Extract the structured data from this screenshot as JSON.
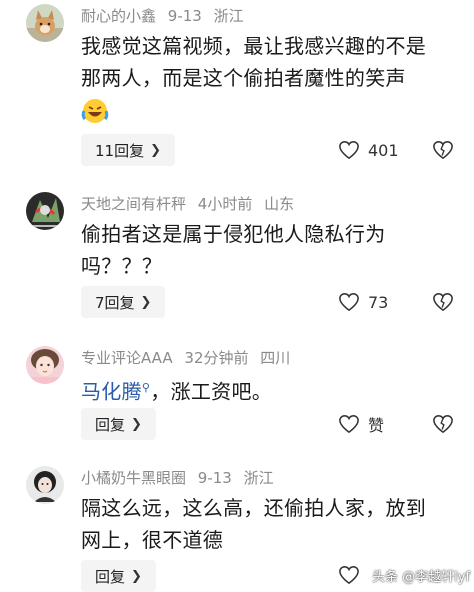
{
  "comments": [
    {
      "username": "耐心的小鑫",
      "date": "9-13",
      "location": "浙江",
      "line1": "我感觉这篇视频，最让我感兴趣的不是",
      "line2": "那两人，而是这个偷拍者魔性的笑声",
      "reply_label": "11回复",
      "like_count": "401",
      "has_emoji": true
    },
    {
      "username": "天地之间有杆秤",
      "date": "4小时前",
      "location": "山东",
      "line1": "偷拍者这是属于侵犯他人隐私行为",
      "line2": "吗？？？",
      "reply_label": "7回复",
      "like_count": "73"
    },
    {
      "username": "专业评论AAA",
      "date": "32分钟前",
      "location": "四川",
      "mention": "马化腾",
      "line1_rest": "，涨工资吧。",
      "reply_label": "回复",
      "like_count": "赞"
    },
    {
      "username": "小橘奶牛黑眼圈",
      "date": "9-13",
      "location": "浙江",
      "line1": "隔这么远，这么高，还偷拍人家，放到",
      "line2": "网上，很不道德",
      "reply_label": "回复"
    }
  ],
  "watermark": "头条 @李越轩lyf",
  "icons": {
    "like": "heart-outline-icon",
    "dislike": "broken-heart-icon",
    "chevron": "chevron-right-icon",
    "emoji": "laughing-crying-emoji-icon"
  }
}
